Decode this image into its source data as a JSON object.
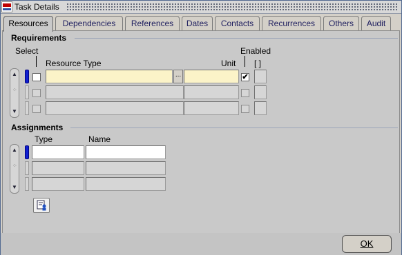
{
  "window": {
    "title": "Task Details"
  },
  "tabs": [
    {
      "label": "Resources",
      "active": true
    },
    {
      "label": "Dependencies",
      "active": false
    },
    {
      "label": "References",
      "active": false
    },
    {
      "label": "Dates",
      "active": false
    },
    {
      "label": "Contacts",
      "active": false
    },
    {
      "label": "Recurrences",
      "active": false
    },
    {
      "label": "Others",
      "active": false
    },
    {
      "label": "Audit",
      "active": false
    }
  ],
  "requirements": {
    "section_label": "Requirements",
    "col_select": "Select",
    "col_resource_type": "Resource Type",
    "col_unit": "Unit",
    "col_enabled": "Enabled",
    "col_flex": "[ ]",
    "rows": [
      {
        "select": false,
        "resource_type": "",
        "unit": "",
        "enabled": true
      },
      {
        "select": false,
        "resource_type": "",
        "unit": "",
        "enabled": false
      },
      {
        "select": false,
        "resource_type": "",
        "unit": "",
        "enabled": false
      }
    ],
    "lov_label": "..."
  },
  "assignments": {
    "section_label": "Assignments",
    "col_type": "Type",
    "col_name": "Name",
    "rows": [
      {
        "type": "",
        "name": ""
      },
      {
        "type": "",
        "name": ""
      },
      {
        "type": "",
        "name": ""
      }
    ]
  },
  "buttons": {
    "ok_label": "OK"
  },
  "icons": {
    "app": "oracle-app-icon",
    "assign": "assign-resource-icon"
  }
}
